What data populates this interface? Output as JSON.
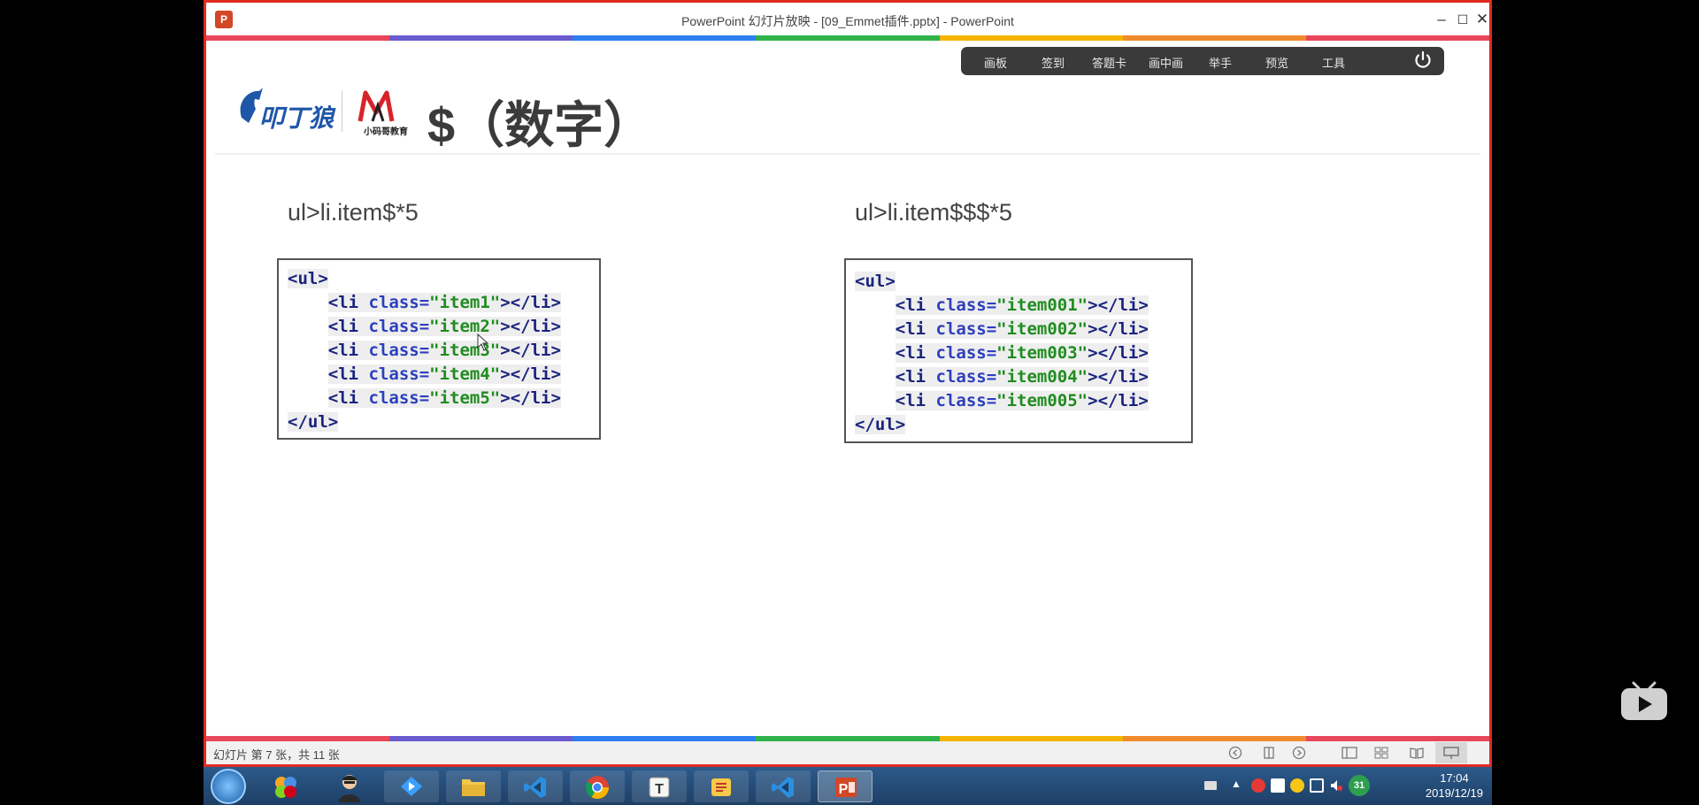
{
  "window": {
    "title": "PowerPoint 幻灯片放映 - [09_Emmet插件.pptx] - PowerPoint",
    "minimize": "–",
    "maximize": "☐",
    "close": "✕"
  },
  "stripe_colors": [
    "#e8475a",
    "#6b5bd0",
    "#2d7ff0",
    "#2fb34a",
    "#f5b400",
    "#f08a2c",
    "#e8475a"
  ],
  "toolbar": {
    "items": [
      "画板",
      "签到",
      "答题卡",
      "画中画",
      "举手",
      "预览",
      "工具"
    ]
  },
  "slide": {
    "logo1_alt": "叩丁狼",
    "logo2_text": "小码哥教育",
    "title": "$（数字）",
    "left": {
      "label": "ul>li.item$*5",
      "lines": [
        {
          "indent": false,
          "parts": [
            {
              "t": "<ul>",
              "c": "tag"
            }
          ]
        },
        {
          "indent": true,
          "parts": [
            {
              "t": "<li ",
              "c": "tag"
            },
            {
              "t": "class=",
              "c": "attr"
            },
            {
              "t": "\"item1\"",
              "c": "str"
            },
            {
              "t": "></li>",
              "c": "tag"
            }
          ]
        },
        {
          "indent": true,
          "parts": [
            {
              "t": "<li ",
              "c": "tag"
            },
            {
              "t": "class=",
              "c": "attr"
            },
            {
              "t": "\"item2\"",
              "c": "str"
            },
            {
              "t": "></li>",
              "c": "tag"
            }
          ]
        },
        {
          "indent": true,
          "parts": [
            {
              "t": "<li ",
              "c": "tag"
            },
            {
              "t": "class=",
              "c": "attr"
            },
            {
              "t": "\"item3\"",
              "c": "str"
            },
            {
              "t": "></li>",
              "c": "tag"
            }
          ]
        },
        {
          "indent": true,
          "parts": [
            {
              "t": "<li ",
              "c": "tag"
            },
            {
              "t": "class=",
              "c": "attr"
            },
            {
              "t": "\"item4\"",
              "c": "str"
            },
            {
              "t": "></li>",
              "c": "tag"
            }
          ]
        },
        {
          "indent": true,
          "parts": [
            {
              "t": "<li ",
              "c": "tag"
            },
            {
              "t": "class=",
              "c": "attr"
            },
            {
              "t": "\"item5\"",
              "c": "str"
            },
            {
              "t": "></li>",
              "c": "tag"
            }
          ]
        },
        {
          "indent": false,
          "parts": [
            {
              "t": "</ul>",
              "c": "tag"
            }
          ]
        }
      ]
    },
    "right": {
      "label": "ul>li.item$$$*5",
      "lines": [
        {
          "indent": false,
          "parts": [
            {
              "t": "<ul>",
              "c": "tag"
            }
          ]
        },
        {
          "indent": true,
          "parts": [
            {
              "t": "<li ",
              "c": "tag"
            },
            {
              "t": "class=",
              "c": "attr"
            },
            {
              "t": "\"item001\"",
              "c": "str"
            },
            {
              "t": "></li>",
              "c": "tag"
            }
          ]
        },
        {
          "indent": true,
          "parts": [
            {
              "t": "<li ",
              "c": "tag"
            },
            {
              "t": "class=",
              "c": "attr"
            },
            {
              "t": "\"item002\"",
              "c": "str"
            },
            {
              "t": "></li>",
              "c": "tag"
            }
          ]
        },
        {
          "indent": true,
          "parts": [
            {
              "t": "<li ",
              "c": "tag"
            },
            {
              "t": "class=",
              "c": "attr"
            },
            {
              "t": "\"item003\"",
              "c": "str"
            },
            {
              "t": "></li>",
              "c": "tag"
            }
          ]
        },
        {
          "indent": true,
          "parts": [
            {
              "t": "<li ",
              "c": "tag"
            },
            {
              "t": "class=",
              "c": "attr"
            },
            {
              "t": "\"item004\"",
              "c": "str"
            },
            {
              "t": "></li>",
              "c": "tag"
            }
          ]
        },
        {
          "indent": true,
          "parts": [
            {
              "t": "<li ",
              "c": "tag"
            },
            {
              "t": "class=",
              "c": "attr"
            },
            {
              "t": "\"item005\"",
              "c": "str"
            },
            {
              "t": "></li>",
              "c": "tag"
            }
          ]
        },
        {
          "indent": false,
          "parts": [
            {
              "t": "</ul>",
              "c": "tag"
            }
          ]
        }
      ]
    }
  },
  "statusbar": {
    "slide_info": "幻灯片 第 7 张，共 11 张"
  },
  "taskbar": {
    "apps": [
      "start",
      "pinwheel",
      "avatar",
      "xunlei",
      "explorer",
      "vscode",
      "chrome",
      "typora",
      "xmind",
      "vscode",
      "powerpoint"
    ],
    "clock_time": "17:04",
    "clock_date": "2019/12/19",
    "tray_badge": "31"
  }
}
